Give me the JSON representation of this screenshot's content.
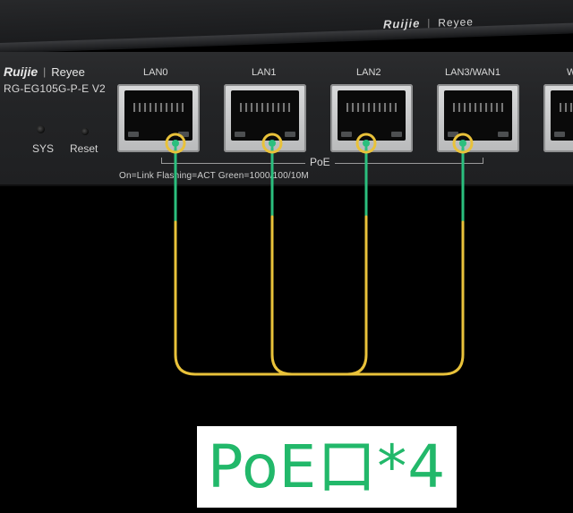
{
  "device": {
    "top_brand": "Ruijie",
    "top_sub_brand": "Reyee",
    "front_brand": "Ruijie",
    "front_sub_brand": "Reyee",
    "model": "RG-EG105G-P-E V2",
    "sys_label": "SYS",
    "reset_label": "Reset",
    "ports": [
      {
        "label": "LAN0"
      },
      {
        "label": "LAN1"
      },
      {
        "label": "LAN2"
      },
      {
        "label": "LAN3/WAN1"
      },
      {
        "label": "W"
      }
    ],
    "poe_label": "PoE",
    "legend": "On=Link  Flashing=ACT  Green=1000/100/10M"
  },
  "caption": {
    "text": "PoE口*4"
  },
  "colors": {
    "cable_yellow": "#e9c23a",
    "cable_green": "#2bbf7e",
    "caption_green": "#22b86a"
  }
}
